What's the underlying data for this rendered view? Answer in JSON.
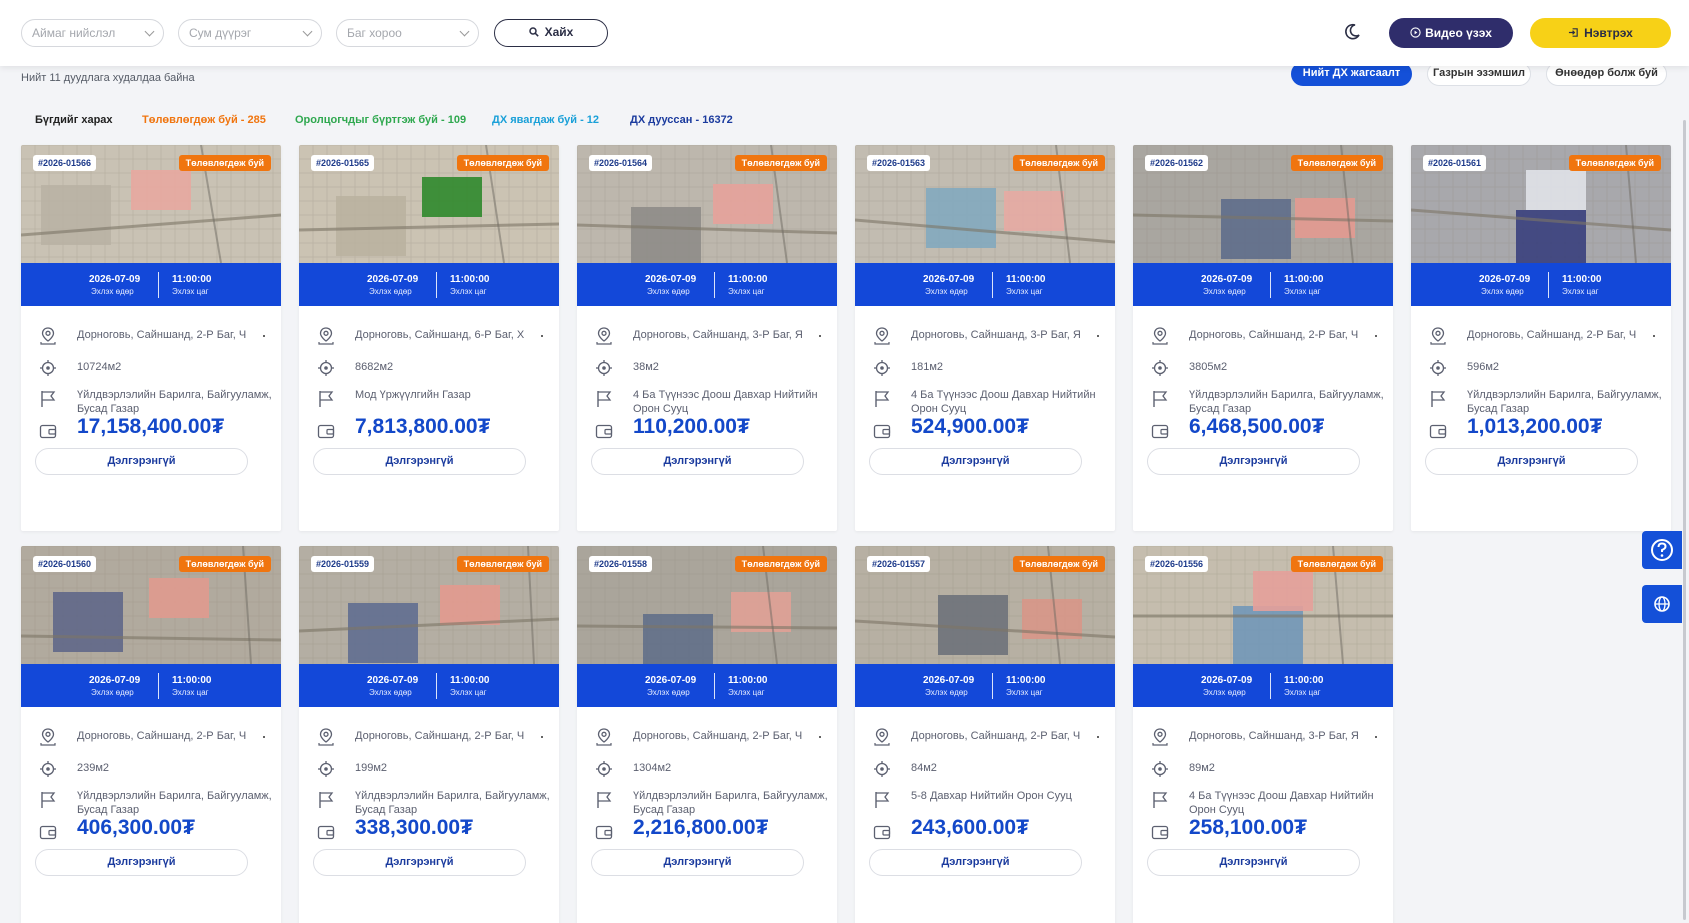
{
  "header": {
    "province_placeholder": "Аймаг нийслэл",
    "district_placeholder": "Сум дүүрэг",
    "subdistrict_placeholder": "Баг хороо",
    "search_label": "Хайх",
    "video_label": "Видео үзэх",
    "login_label": "Нэвтрэх"
  },
  "summary": {
    "total_text": "Нийт 11 дуудлага худалдаа байна",
    "btn_all_auction": "Нийт ДХ жагсаалт",
    "btn_land_possession": "Газрын эзэмшил",
    "btn_today": "Өнөөдөр болж буй"
  },
  "filters": {
    "all": "Бүгдийг харах",
    "planning": "Төлөвлөгдөж буй - 285",
    "registering": "Оролцогчдыг бүртгэж буй - 109",
    "ongoing": "ДХ явагдаж буй - 12",
    "finished": "ДХ дууссан - 16372"
  },
  "colors": {
    "primary_blue": "#1348d9",
    "accent_yellow": "#f7d117",
    "planning_orange": "#f0750f",
    "registering_green": "#2fa84f",
    "ongoing_cyan": "#1aa0d8",
    "finished_navy": "#1b3b9e",
    "dark_navy": "#2f2d6b"
  },
  "card_labels": {
    "status": "Төлөвлөгдөж буй",
    "start_date_label": "Эхлэх өдөр",
    "start_time_label": "Эхлэх цаг",
    "details": "Дэлгэрэнгүй"
  },
  "icons": {
    "search": "search-icon",
    "moon": "moon-icon",
    "video": "play-circle-icon",
    "login": "login-icon",
    "location": "map-pin-icon",
    "area": "crosshair-icon",
    "type": "flag-icon",
    "price": "wallet-icon",
    "help": "help-circle-icon",
    "language": "globe-icon"
  },
  "cards": [
    {
      "id": "#2026-01566",
      "date": "2026-07-09",
      "time": "11:00:00",
      "location": "Дорноговь, Сайншанд, 2-Р Баг, Ч",
      "area": "10724м2",
      "type": "Үйлдвэрлэлийн Барилга, Байгууламж, Бусад Газар",
      "price": "17,158,400.00₮"
    },
    {
      "id": "#2026-01565",
      "date": "2026-07-09",
      "time": "11:00:00",
      "location": "Дорноговь, Сайншанд, 6-Р Баг, Х",
      "area": "8682м2",
      "type": "Мод Үржүүлгийн Газар",
      "price": "7,813,800.00₮"
    },
    {
      "id": "#2026-01564",
      "date": "2026-07-09",
      "time": "11:00:00",
      "location": "Дорноговь, Сайншанд, 3-Р Баг, Я",
      "area": "38м2",
      "type": "4 Ба Түүнээс Доош Давхар Нийтийн Орон Сууц",
      "price": "110,200.00₮"
    },
    {
      "id": "#2026-01563",
      "date": "2026-07-09",
      "time": "11:00:00",
      "location": "Дорноговь, Сайншанд, 3-Р Баг, Я",
      "area": "181м2",
      "type": "4 Ба Түүнээс Доош Давхар Нийтийн Орон Сууц",
      "price": "524,900.00₮"
    },
    {
      "id": "#2026-01562",
      "date": "2026-07-09",
      "time": "11:00:00",
      "location": "Дорноговь, Сайншанд, 2-Р Баг, Ч",
      "area": "3805м2",
      "type": "Үйлдвэрлэлийн Барилга, Байгууламж, Бусад Газар",
      "price": "6,468,500.00₮"
    },
    {
      "id": "#2026-01561",
      "date": "2026-07-09",
      "time": "11:00:00",
      "location": "Дорноговь, Сайншанд, 2-Р Баг, Ч",
      "area": "596м2",
      "type": "Үйлдвэрлэлийн Барилга, Байгууламж, Бусад Газар",
      "price": "1,013,200.00₮"
    },
    {
      "id": "#2026-01560",
      "date": "2026-07-09",
      "time": "11:00:00",
      "location": "Дорноговь, Сайншанд, 2-Р Баг, Ч",
      "area": "239м2",
      "type": "Үйлдвэрлэлийн Барилга, Байгууламж, Бусад Газар",
      "price": "406,300.00₮"
    },
    {
      "id": "#2026-01559",
      "date": "2026-07-09",
      "time": "11:00:00",
      "location": "Дорноговь, Сайншанд, 2-Р Баг, Ч",
      "area": "199м2",
      "type": "Үйлдвэрлэлийн Барилга, Байгууламж, Бусад Газар",
      "price": "338,300.00₮"
    },
    {
      "id": "#2026-01558",
      "date": "2026-07-09",
      "time": "11:00:00",
      "location": "Дорноговь, Сайншанд, 2-Р Баг, Ч",
      "area": "1304м2",
      "type": "Үйлдвэрлэлийн Барилга, Байгууламж, Бусад Газар",
      "price": "2,216,800.00₮"
    },
    {
      "id": "#2026-01557",
      "date": "2026-07-09",
      "time": "11:00:00",
      "location": "Дорноговь, Сайншанд, 2-Р Баг, Ч",
      "area": "84м2",
      "type": "5-8 Давхар Нийтийн Орон Сууц",
      "price": "243,600.00₮"
    },
    {
      "id": "#2026-01556",
      "date": "2026-07-09",
      "time": "11:00:00",
      "location": "Дорноговь, Сайншанд, 3-Р Баг, Я",
      "area": "89м2",
      "type": "4 Ба Түүнээс Доош Давхар Нийтийн Орон Сууц",
      "price": "258,100.00₮"
    }
  ]
}
